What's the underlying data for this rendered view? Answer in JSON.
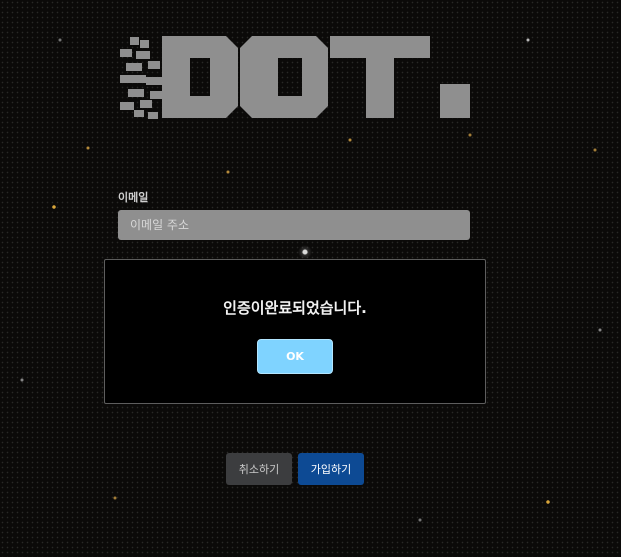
{
  "logo": {
    "text": "DOT.",
    "color": "#8f8f8f"
  },
  "form": {
    "email_label": "이메일",
    "email_placeholder": "이메일 주소",
    "email_value": ""
  },
  "modal": {
    "message": "인증이완료되었습니다.",
    "ok_label": "OK"
  },
  "actions": {
    "cancel_label": "취소하기",
    "signup_label": "가입하기"
  },
  "colors": {
    "background": "#0b0a09",
    "input_bg": "#8f8f8f",
    "ok_button": "#7fd3ff",
    "cancel_button": "#3c3d3f",
    "signup_button": "#0d4a94"
  }
}
